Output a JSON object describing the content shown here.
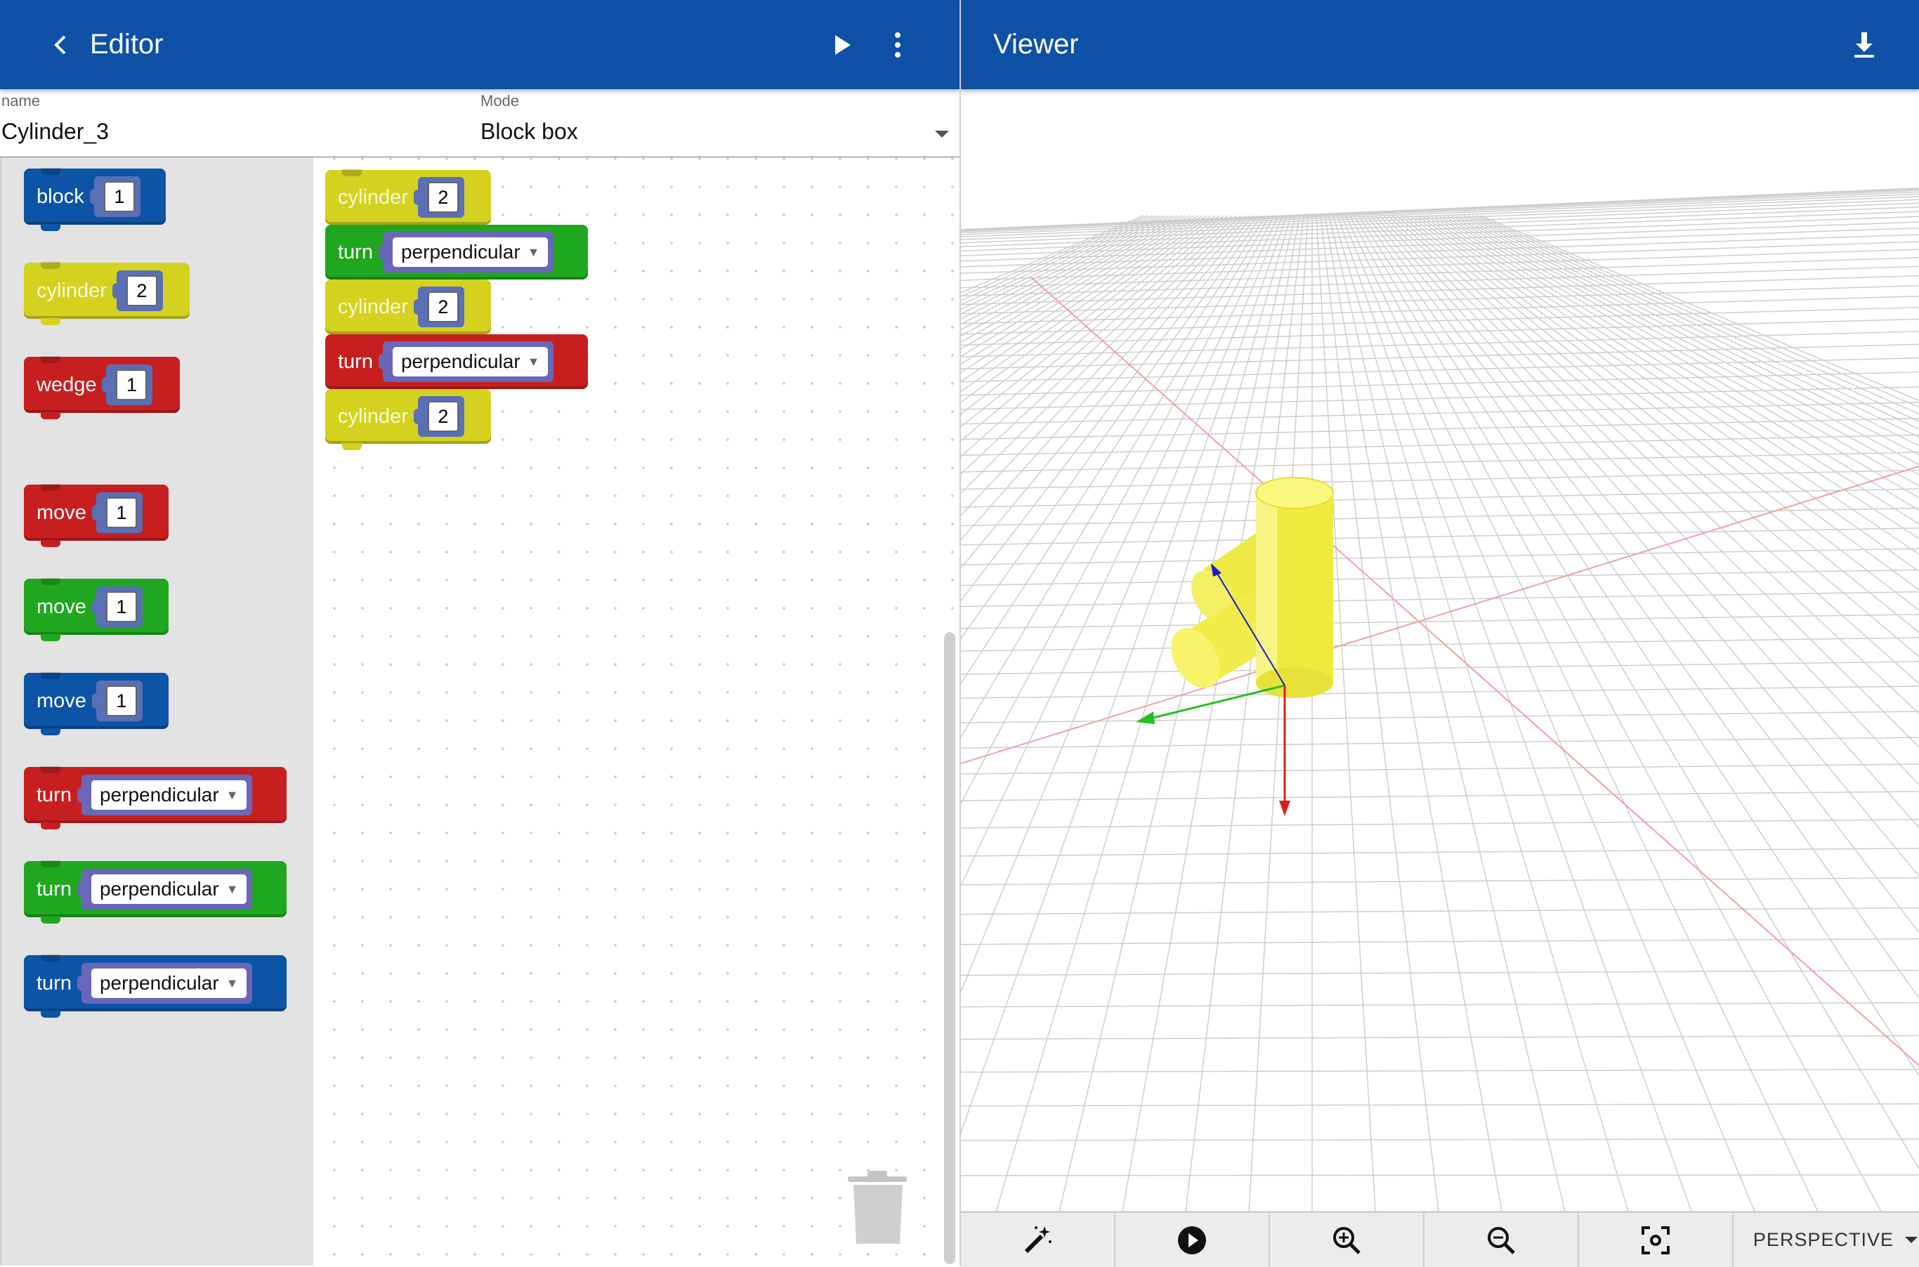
{
  "editor": {
    "title": "Editor",
    "name_label": "name",
    "name_value": "Cylinder_3",
    "mode_label": "Mode",
    "mode_value": "Block box"
  },
  "viewer": {
    "title": "Viewer",
    "projection": "PERSPECTIVE"
  },
  "toolbox": [
    {
      "kw": "block",
      "value": "1",
      "color": "#0c54a6"
    },
    {
      "kw": "cylinder",
      "value": "2",
      "color": "#d4d21f"
    },
    {
      "kw": "wedge",
      "value": "1",
      "color": "#c71f1f"
    },
    {
      "kw": "move",
      "value": "1",
      "color": "#c71f1f"
    },
    {
      "kw": "move",
      "value": "1",
      "color": "#1fa81f"
    },
    {
      "kw": "move",
      "value": "1",
      "color": "#0c54a6"
    },
    {
      "kw": "turn",
      "value": "perpendicular",
      "color": "#c71f1f"
    },
    {
      "kw": "turn",
      "value": "perpendicular",
      "color": "#1fa81f"
    },
    {
      "kw": "turn",
      "value": "perpendicular",
      "color": "#0c54a6"
    }
  ],
  "program": [
    {
      "kw": "cylinder",
      "value": "2",
      "color": "#d4d21f"
    },
    {
      "kw": "turn",
      "value": "perpendicular",
      "color": "#1fa81f"
    },
    {
      "kw": "cylinder",
      "value": "2",
      "color": "#d4d21f"
    },
    {
      "kw": "turn",
      "value": "perpendicular",
      "color": "#c71f1f"
    },
    {
      "kw": "cylinder",
      "value": "2",
      "color": "#d4d21f"
    }
  ],
  "icons": {
    "back": "chevron-left-icon",
    "run": "play-icon",
    "more": "more-vert-icon",
    "download": "download-icon",
    "trash": "trash-icon",
    "wand": "magic-wand-icon",
    "play_circle": "play-circle-icon",
    "zoom_in": "zoom-in-icon",
    "zoom_out": "zoom-out-icon",
    "focus": "center-focus-icon"
  },
  "colors": {
    "appbar": "#0e51a6",
    "axis_x": "#d42020",
    "axis_y": "#22c022",
    "axis_z": "#1010c8",
    "cylinder": "#f5f05a"
  }
}
